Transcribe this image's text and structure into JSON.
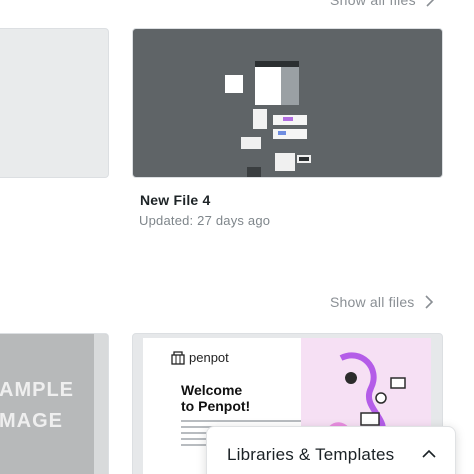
{
  "top_section": {
    "show_all_files_label": "Show all files"
  },
  "recent_file": {
    "name": "New File 4",
    "updated": "Updated: 27 days ago"
  },
  "section_two": {
    "show_all_files_label": "Show all files"
  },
  "sample_card": {
    "line1": "AMPLE",
    "line2": "MAGE"
  },
  "welcome_card": {
    "brand": "penpot",
    "title_line1": "Welcome",
    "title_line2": "to Penpot!"
  },
  "libraries_panel": {
    "label": "Libraries & Templates"
  },
  "colors": {
    "dark_thumb": "#5f6467",
    "muted_text": "#8a8f94",
    "pink_panel": "#f6e0f4"
  }
}
